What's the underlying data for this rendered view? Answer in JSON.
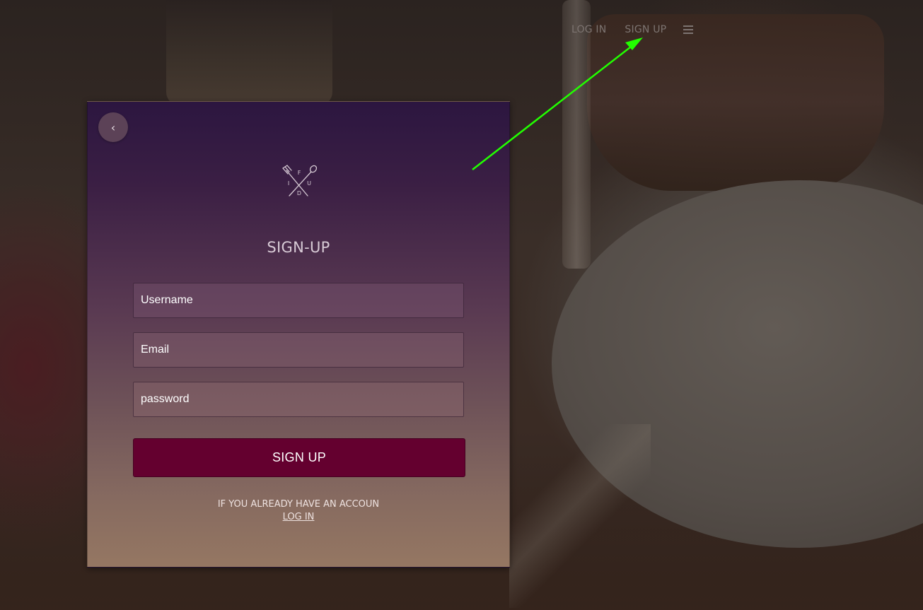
{
  "nav": {
    "login_label": "LOG IN",
    "signup_label": "SIGN UP",
    "menu_icon": "hamburger-menu-icon"
  },
  "card": {
    "back_label": "‹",
    "logo_letters": [
      "F",
      "I",
      "U",
      "D"
    ],
    "title": "SIGN-UP",
    "username_placeholder": "Username",
    "email_placeholder": "Email",
    "password_placeholder": "password",
    "submit_label": "SIGN UP",
    "footer_text": "IF YOU ALREADY HAVE AN ACCOUN",
    "footer_link": "LOG IN"
  },
  "colors": {
    "annotation_arrow": "#22ff00",
    "submit_button": "#64002f",
    "card_top": "#2c1640",
    "card_bottom": "#957762"
  }
}
